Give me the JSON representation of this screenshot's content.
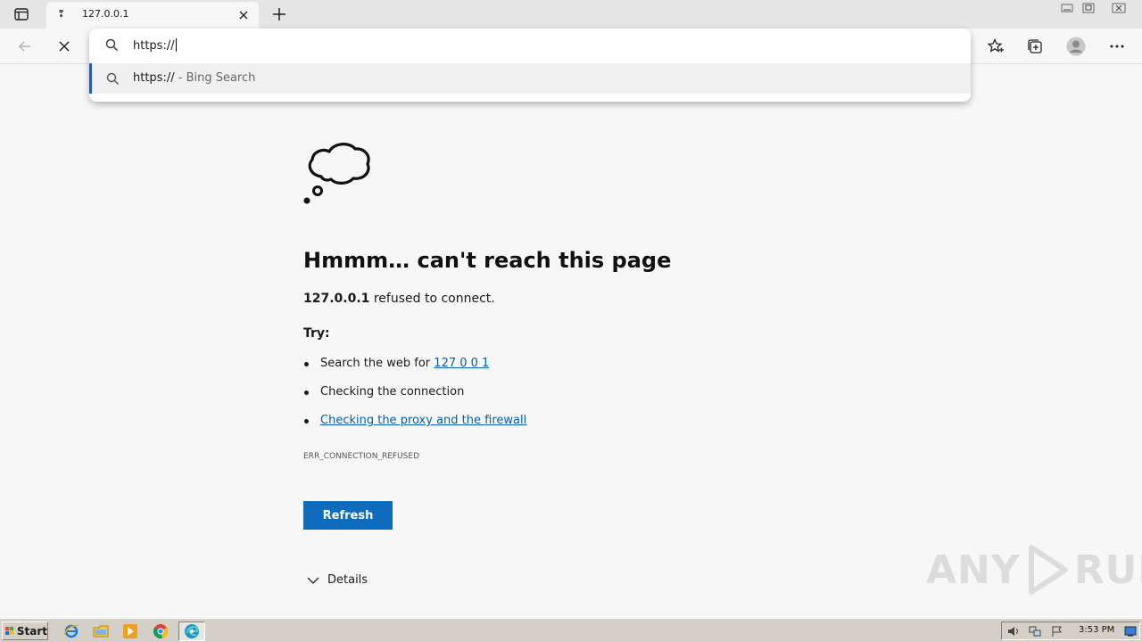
{
  "browser": {
    "tab": {
      "title": "127.0.0.1",
      "favicon_glyph": "❢"
    },
    "icons": {
      "tab_actions": "tab-actions-icon",
      "close": "close-icon",
      "new_tab": "plus-icon",
      "back": "back-arrow-icon",
      "stop": "stop-icon",
      "favorites": "favorites-icon",
      "collections": "collections-icon",
      "profile": "profile-avatar-icon",
      "more": "more-icon"
    }
  },
  "omnibox": {
    "text": "https://",
    "suggestion": {
      "text": "https://",
      "suffix": " - Bing Search"
    }
  },
  "error_page": {
    "title": "Hmmm… can't reach this page",
    "host": "127.0.0.1",
    "refused_text": " refused to connect.",
    "try_label": "Try:",
    "suggestion_search_prefix": "Search the web for ",
    "suggestion_search_link": "127 0 0 1",
    "suggestion_connection": "Checking the connection",
    "suggestion_proxy": "Checking the proxy and the firewall",
    "error_code": "ERR_CONNECTION_REFUSED",
    "refresh_label": "Refresh",
    "details_label": "Details"
  },
  "watermark": {
    "left": "ANY",
    "right": "RUN"
  },
  "taskbar": {
    "start_label": "Start",
    "clock": "3:53 PM",
    "apps": [
      "ie-icon",
      "explorer-icon",
      "media-player-icon",
      "chrome-icon",
      "edge-icon"
    ]
  },
  "colors": {
    "accent": "#0f6cbd",
    "link": "#0a5ea8",
    "selection_bar": "#2a5ca8"
  }
}
